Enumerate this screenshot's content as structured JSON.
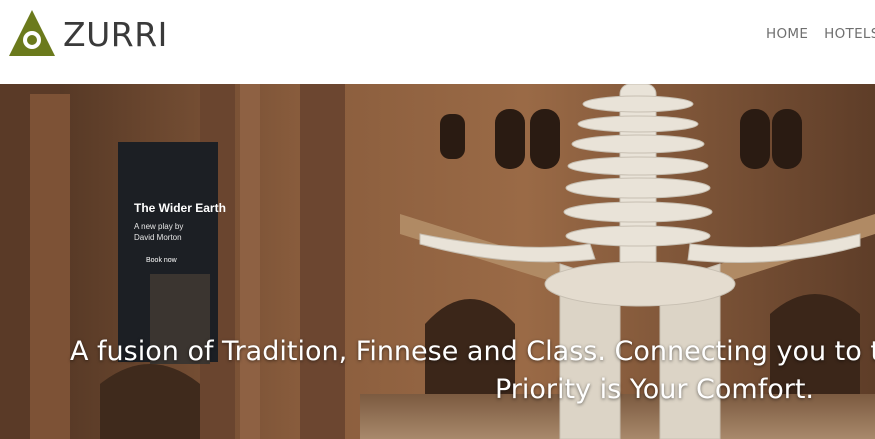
{
  "brand": {
    "name": "ZURRI",
    "color": "#6b7a1c"
  },
  "nav": {
    "items": [
      "HOME",
      "HOTELS"
    ]
  },
  "hero": {
    "poster": {
      "title": "The Wider Earth",
      "subtitle_lines": [
        "A new play by",
        "David Morton"
      ],
      "cta": "Book now"
    },
    "caption_line1": "A fusion of Tradition, Finnese and Class. Connecting you to the",
    "caption_line2": "Priority is Your Comfort."
  }
}
